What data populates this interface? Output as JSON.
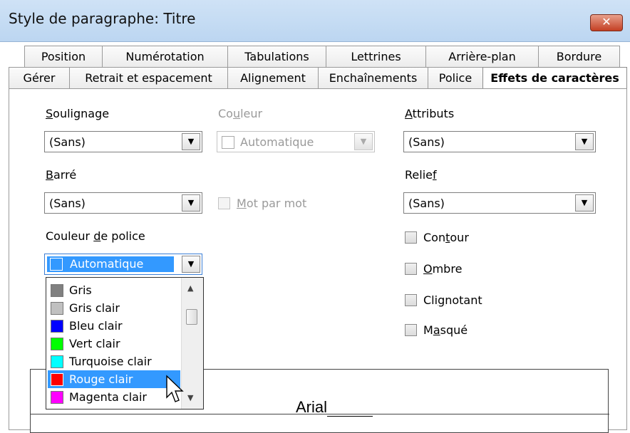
{
  "window": {
    "title": "Style de paragraphe: Titre",
    "close_label": "✕"
  },
  "tabs": {
    "row1": [
      "Position",
      "Numérotation",
      "Tabulations",
      "Lettrines",
      "Arrière-plan",
      "Bordure"
    ],
    "row2": [
      "Gérer",
      "Retrait et espacement",
      "Alignement",
      "Enchaînements",
      "Police",
      "Effets de caractères"
    ],
    "active": "Effets de caractères"
  },
  "underline": {
    "label": "Soulignage",
    "value": "(Sans)"
  },
  "underline_color": {
    "label": "Couleur",
    "value": "Automatique"
  },
  "attributes": {
    "label": "Attributs",
    "value": "(Sans)"
  },
  "strikethrough": {
    "label": "Barré",
    "value": "(Sans)"
  },
  "word_by_word": {
    "label": "Mot par mot"
  },
  "relief": {
    "label": "Relief",
    "value": "(Sans)"
  },
  "font_color": {
    "label": "Couleur de police",
    "value": "Automatique",
    "options": [
      {
        "label": "Gris",
        "color": "#808080"
      },
      {
        "label": "Gris clair",
        "color": "#c0c0c0"
      },
      {
        "label": "Bleu clair",
        "color": "#0000ff"
      },
      {
        "label": "Vert clair",
        "color": "#00ff00"
      },
      {
        "label": "Turquoise clair",
        "color": "#00ffff"
      },
      {
        "label": "Rouge clair",
        "color": "#ff0000"
      },
      {
        "label": "Magenta clair",
        "color": "#ff00ff"
      }
    ],
    "highlighted": "Rouge clair"
  },
  "checkboxes": {
    "outline": "Contour",
    "shadow": "Ombre",
    "blinking": "Clignotant",
    "hidden": "Masqué"
  },
  "preview": {
    "text": "Arial"
  }
}
